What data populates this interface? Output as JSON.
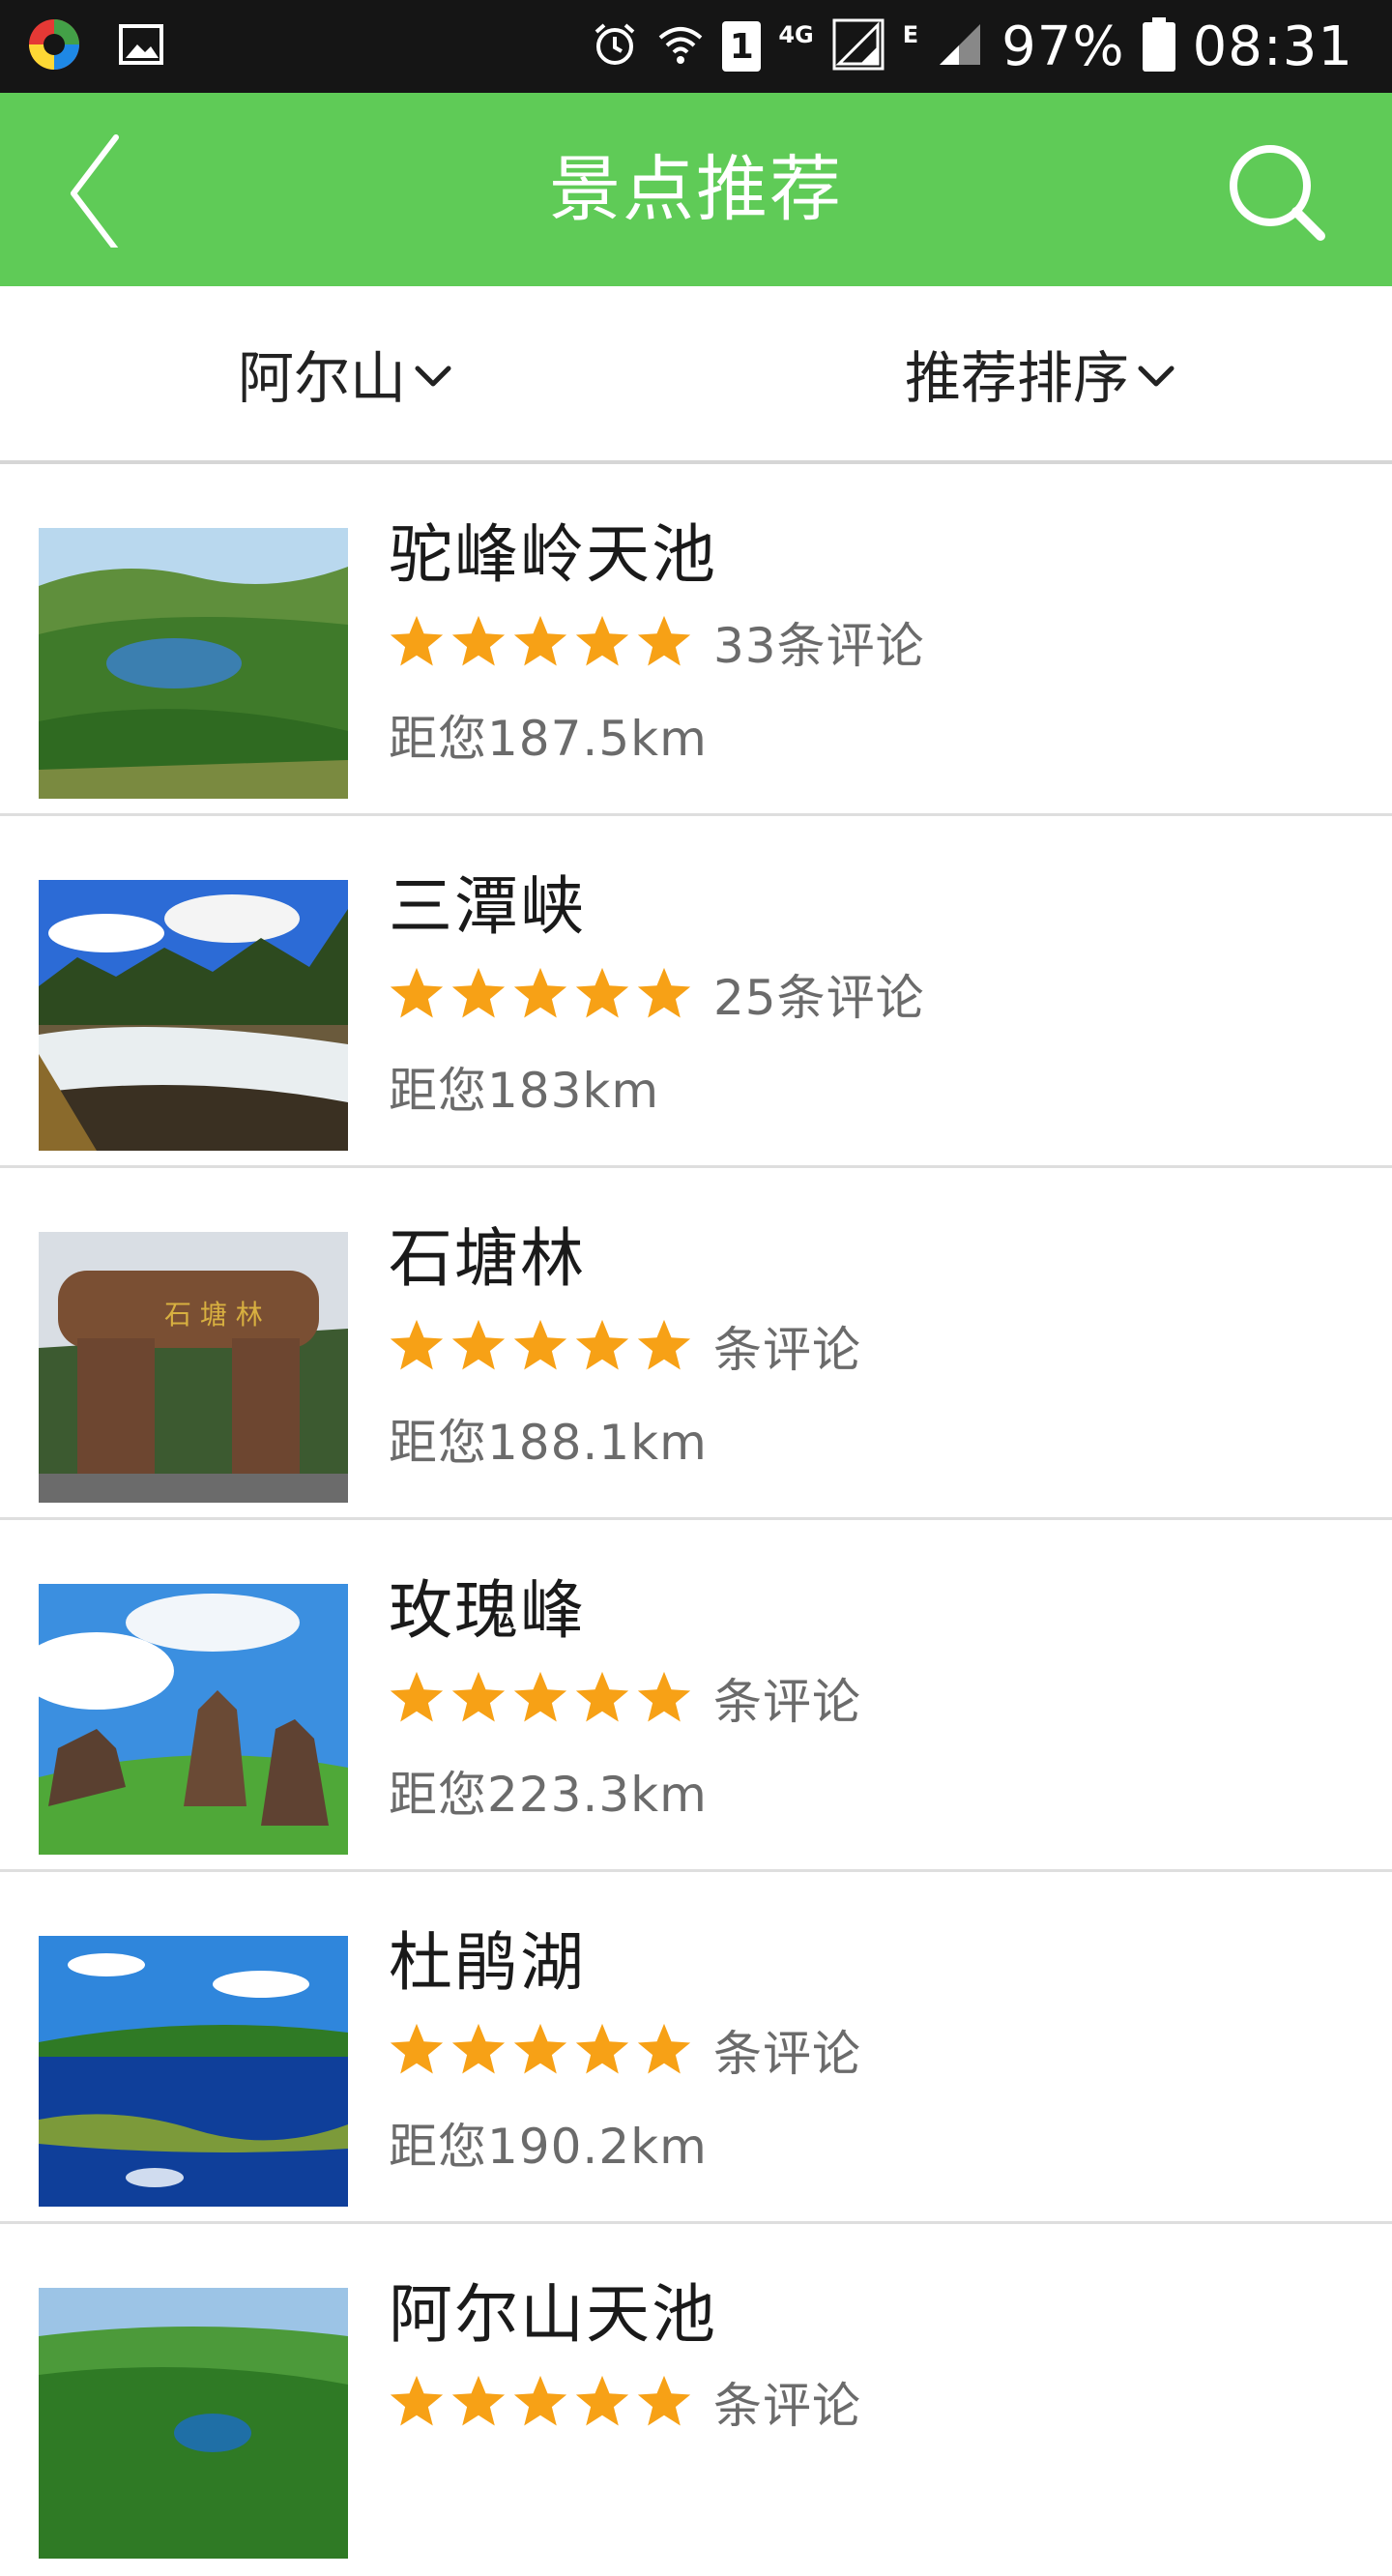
{
  "status_bar": {
    "battery": "97%",
    "time": "08:31",
    "network_4g": "4G",
    "network_e": "E",
    "sim_badge": "1",
    "icons": [
      "app-logo-icon",
      "image-icon",
      "alarm-icon",
      "wifi-icon",
      "sim-icon",
      "signal-icon",
      "battery-icon"
    ]
  },
  "app_bar": {
    "title": "景点推荐",
    "back_icon": "back-arrow-icon",
    "search_icon": "search-icon",
    "color": "#5fcb57"
  },
  "filters": {
    "location": "阿尔山",
    "sort": "推荐排序"
  },
  "colors": {
    "star": "#f7a116",
    "secondary_text": "#6b6b6b"
  },
  "attractions": [
    {
      "name": "驼峰岭天池",
      "rating": 5,
      "reviews": "33条评论",
      "distance": "距您187.5km"
    },
    {
      "name": "三潭峡",
      "rating": 5,
      "reviews": "25条评论",
      "distance": "距您183km"
    },
    {
      "name": "石塘林",
      "rating": 5,
      "reviews": "条评论",
      "distance": "距您188.1km"
    },
    {
      "name": "玫瑰峰",
      "rating": 5,
      "reviews": "条评论",
      "distance": "距您223.3km"
    },
    {
      "name": "杜鹃湖",
      "rating": 5,
      "reviews": "条评论",
      "distance": "距您190.2km"
    },
    {
      "name": "阿尔山天池",
      "rating": 5,
      "reviews": "条评论",
      "distance": ""
    }
  ]
}
